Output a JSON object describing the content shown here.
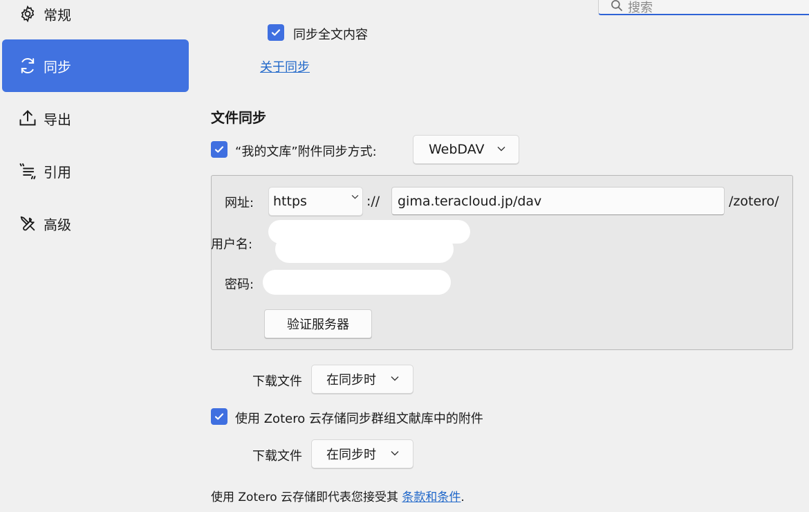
{
  "sidebar": {
    "items": [
      {
        "label": "常规",
        "icon": "gear-icon"
      },
      {
        "label": "同步",
        "icon": "sync-icon",
        "active": true
      },
      {
        "label": "导出",
        "icon": "export-icon"
      },
      {
        "label": "引用",
        "icon": "cite-icon"
      },
      {
        "label": "高级",
        "icon": "tools-icon"
      }
    ]
  },
  "search": {
    "placeholder": "搜索"
  },
  "sync": {
    "full_text_label": "同步全文内容",
    "full_text_checked": true,
    "about_link": "关于同步"
  },
  "file_sync": {
    "title": "文件同步",
    "my_library_label": "“我的文库”附件同步方式:",
    "my_library_checked": true,
    "method_value": "WebDAV",
    "url_label": "网址:",
    "protocol_value": "https",
    "protocol_sep": "://",
    "url_value": "gima.teracloud.jp/dav",
    "url_suffix": "/zotero/",
    "username_label": "用户名:",
    "password_label": "密码:",
    "verify_button": "验证服务器",
    "download_label_1": "下载文件",
    "download_value_1": "在同步时",
    "group_label": "使用 Zotero 云存储同步群组文献库中的附件",
    "group_checked": true,
    "download_label_2": "下载文件",
    "download_value_2": "在同步时",
    "terms_prefix": "使用 Zotero 云存储即代表您接受其 ",
    "terms_link": "条款和条件",
    "terms_suffix": "."
  },
  "colors": {
    "accent": "#4172e0",
    "link": "#1e66c9",
    "background": "#f0f0f0"
  }
}
